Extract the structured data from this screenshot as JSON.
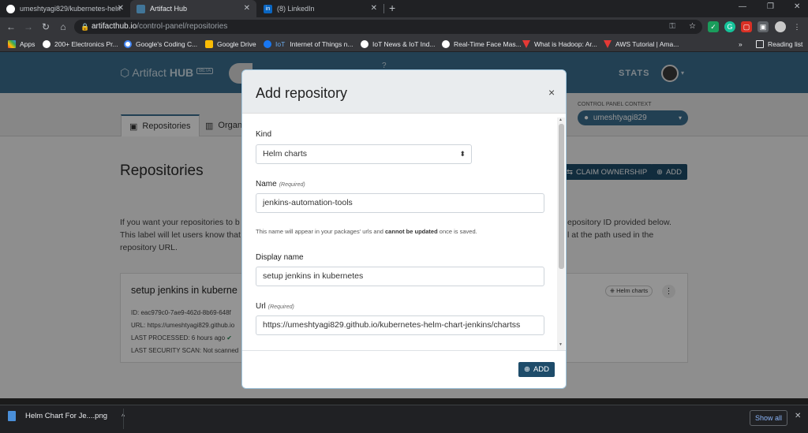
{
  "browser": {
    "tabs": [
      {
        "title": "umeshtyagi829/kubernetes-helm",
        "active": false
      },
      {
        "title": "Artifact Hub",
        "active": true
      },
      {
        "title": "(8) LinkedIn",
        "active": false
      }
    ],
    "new_tab": "+",
    "url_host": "artifacthub.io",
    "url_path": "/control-panel/repositories",
    "reading_list": "Reading list",
    "bookmarks_more": "»",
    "bookmarks": [
      {
        "label": "Apps"
      },
      {
        "label": "200+ Electronics Pr..."
      },
      {
        "label": "Google's Coding C..."
      },
      {
        "label": "Google Drive"
      },
      {
        "label": "Internet of Things n..."
      },
      {
        "label": "IoT News & IoT Ind..."
      },
      {
        "label": "Real-Time Face Mas..."
      },
      {
        "label": "What is Hadoop: Ar..."
      },
      {
        "label": "AWS Tutorial | Ama..."
      }
    ]
  },
  "site": {
    "logo_text": "Artifact",
    "logo_bold": "HUB",
    "beta": "BETA",
    "stats": "STATS",
    "control_panel_context_label": "CONTROL PANEL CONTEXT",
    "context_user": "umeshtyagi829"
  },
  "page": {
    "tab_repositories": "Repositories",
    "tab_organizations": "Organ",
    "title": "Repositories",
    "claim_ownership": "CLAIM OWNERSHIP",
    "add": "ADD",
    "info_line1_left": "If you want your repositories to b",
    "info_line1_right": "epository ID provided below.",
    "info_line2_left": "This label will let users know that",
    "info_line2_right": "l at the path used in the",
    "info_line3": "repository URL.",
    "repo": {
      "name": "setup jenkins in kuberne",
      "id_label": "ID:",
      "id_value": "eac979c0-7ae9-462d-8b69-648f",
      "url_label": "URL:",
      "url_value": "https://umeshtyagi829.github.io",
      "last_processed_label": "LAST PROCESSED:",
      "last_processed_value": "6 hours ago",
      "last_scan_label": "LAST SECURITY SCAN:",
      "last_scan_value": "Not scanned",
      "kind_badge": "Helm charts"
    }
  },
  "modal": {
    "title": "Add repository",
    "close": "×",
    "kind_label": "Kind",
    "kind_value": "Helm charts",
    "name_label": "Name",
    "required": "(Required)",
    "name_value": "jenkins-automation-tools",
    "name_help_before": "This name will appear in your packages' urls and ",
    "name_help_bold": "cannot be updated",
    "name_help_after": " once is saved.",
    "display_name_label": "Display name",
    "display_name_value": "setup jenkins in kubernetes",
    "url_label": "Url",
    "url_value": "https://umeshtyagi829.github.io/kubernetes-helm-chart-jenkins/chartss",
    "add_button": "ADD"
  },
  "downloads": {
    "file": "Helm Chart For Je....png",
    "show_all": "Show all"
  },
  "colors": {
    "brand": "#3b6e8f",
    "button_dark": "#1e4c6a"
  }
}
